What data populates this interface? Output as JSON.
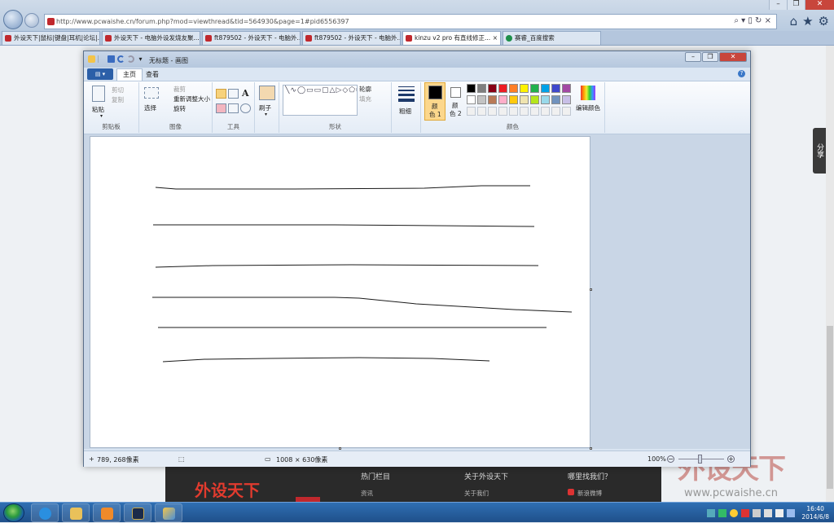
{
  "browser": {
    "address": "http://www.pcwaishe.cn/forum.php?mod=viewthread&tid=564930&page=1#pid6556397",
    "tabs": [
      {
        "label": "外设天下|鼠标|键盘|耳机|论坛|...",
        "active": false
      },
      {
        "label": "外设天下 - 电脑外设发烧友聚...",
        "active": false
      },
      {
        "label": "ft879502 - 外设天下 - 电脑外...",
        "active": false
      },
      {
        "label": "ft879502 - 外设天下 - 电脑外...",
        "active": false
      },
      {
        "label": "kinzu v2 pro 有直线修正...",
        "active": true
      },
      {
        "label": "赛睿_百度搜索",
        "active": false
      }
    ],
    "tab_close": "×"
  },
  "website": {
    "share": "分享",
    "footer_logo": "外设天下",
    "footer_col1": "热门栏目",
    "footer_col1_item": "资讯",
    "footer_col2": "关于外设天下",
    "footer_col2_item": "关于我们",
    "footer_col3": "哪里找我们？",
    "footer_col3_item": "新浪微博",
    "watermark": "外设天下",
    "watermark_url": "www.pcwaishe.cn"
  },
  "paint": {
    "title": "无标题 - 画图",
    "tabs": {
      "home": "主页",
      "view": "查看"
    },
    "groups": {
      "clipboard": {
        "label": "剪贴板",
        "paste": "粘贴",
        "cut": "剪切",
        "copy": "复制"
      },
      "image": {
        "label": "图像",
        "select": "选择",
        "crop": "裁剪",
        "resize": "重新调整大小",
        "rotate": "旋转"
      },
      "tools": {
        "label": "工具"
      },
      "brushes": {
        "label": "刷子"
      },
      "shapes": {
        "label": "形状",
        "outline": "轮廓",
        "fill": "填充"
      },
      "size": {
        "label": "粗细"
      },
      "colors": {
        "label": "颜色",
        "color1_a": "颜",
        "color1_b": "色 1",
        "color2_a": "颜",
        "color2_b": "色 2",
        "edit": "编辑颜色"
      }
    },
    "palette": [
      "#000000",
      "#7f7f7f",
      "#880015",
      "#ed1c24",
      "#ff7f27",
      "#fff200",
      "#22b14c",
      "#00a2e8",
      "#3f48cc",
      "#a349a4",
      "#ffffff",
      "#c3c3c3",
      "#b97a57",
      "#ffaec9",
      "#ffc90e",
      "#efe4b0",
      "#b5e61d",
      "#99d9ea",
      "#7092be",
      "#c8bfe7"
    ],
    "color1": "#000000",
    "color2": "#ffffff",
    "status": {
      "cursor": "789, 268像素",
      "size": "1008 × 630像素",
      "zoom": "100%"
    }
  },
  "taskbar": {
    "time": "16:40",
    "date": "2014/6/8"
  }
}
